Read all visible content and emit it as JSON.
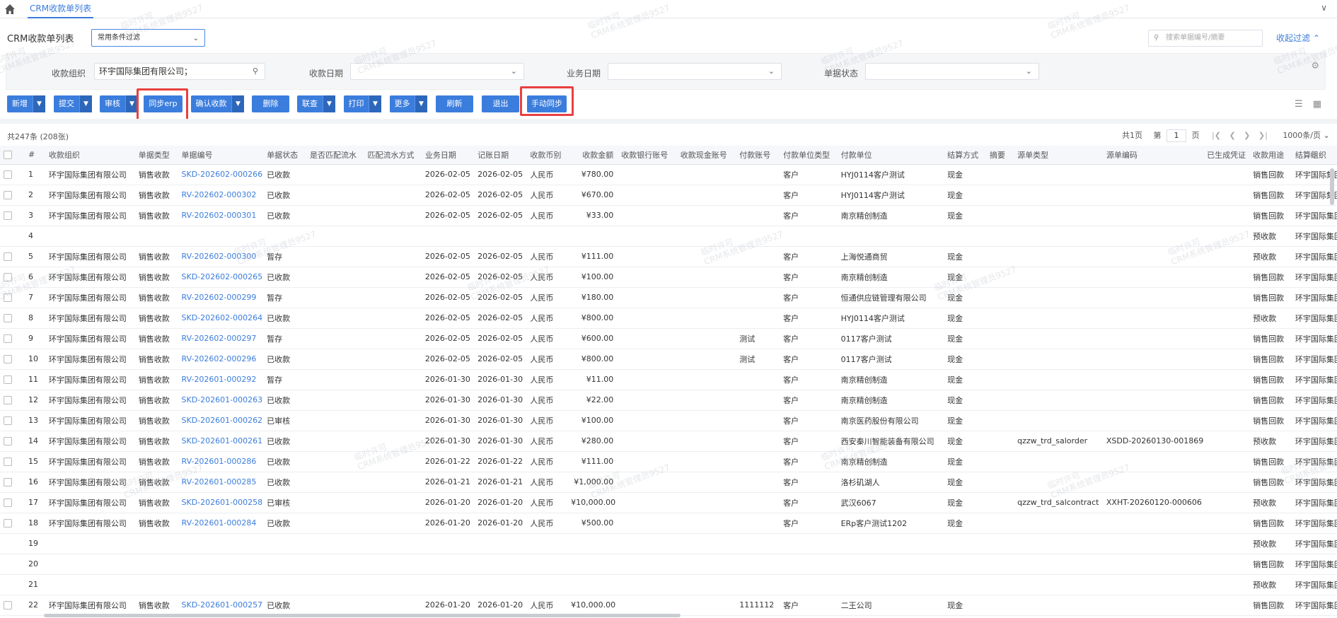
{
  "tab": {
    "label": "CRM收款单列表"
  },
  "page": {
    "title": "CRM收款单列表",
    "filter_scheme": "常用条件过滤",
    "search_placeholder": "搜索单据编号/摘要",
    "collapse_filter": "收起过滤"
  },
  "filters": {
    "org_label": "收款组织",
    "org_value": "环宇国际集团有限公司；",
    "date_label": "收款日期",
    "biz_date_label": "业务日期",
    "status_label": "单据状态"
  },
  "toolbar": {
    "add": "新增",
    "submit": "提交",
    "audit": "审核",
    "sync_erp": "同步erp",
    "confirm": "确认收款",
    "delete": "删除",
    "link": "联查",
    "print": "打印",
    "more": "更多",
    "refresh": "刷新",
    "exit": "退出",
    "manual_sync": "手动同步"
  },
  "list": {
    "summary": "共247条 (208张)",
    "pager": {
      "pages": "共1页",
      "page_prefix": "第",
      "page": "1",
      "page_suffix": "页",
      "page_size": "1000条/页"
    }
  },
  "columns": [
    "#",
    "收款组织",
    "单据类型",
    "单据编号",
    "单据状态",
    "是否匹配流水",
    "匹配流水方式",
    "业务日期",
    "记账日期",
    "收款币别",
    "收款金额",
    "收款银行账号",
    "收款现金账号",
    "付款账号",
    "付款单位类型",
    "付款单位",
    "结算方式",
    "摘要",
    "源单类型",
    "源单编码",
    "已生成凭证",
    "收款用途",
    "结算组织"
  ],
  "rows": [
    {
      "no": "1",
      "org": "环宇国际集团有限公司",
      "type": "销售收款",
      "bill": "SKD-202602-000266",
      "status": "已收款",
      "biz": "2026-02-05",
      "acc": "2026-02-05",
      "cur": "人民币",
      "amt": "¥780.00",
      "payacc": "",
      "ptype": "客户",
      "payer": "HYJ0114客户测试",
      "settle": "现金",
      "srctype": "",
      "srccode": "",
      "use": "销售回款",
      "sorg": "环宇国际集团有限"
    },
    {
      "no": "2",
      "org": "环宇国际集团有限公司",
      "type": "销售收款",
      "bill": "RV-202602-000302",
      "status": "已收款",
      "biz": "2026-02-05",
      "acc": "2026-02-05",
      "cur": "人民币",
      "amt": "¥670.00",
      "payacc": "",
      "ptype": "客户",
      "payer": "HYJ0114客户测试",
      "settle": "现金",
      "srctype": "",
      "srccode": "",
      "use": "销售回款",
      "sorg": "环宇国际集团有限"
    },
    {
      "no": "3",
      "org": "环宇国际集团有限公司",
      "type": "销售收款",
      "bill": "RV-202602-000301",
      "status": "已收款",
      "biz": "2026-02-05",
      "acc": "2026-02-05",
      "cur": "人民币",
      "amt": "¥33.00",
      "payacc": "",
      "ptype": "客户",
      "payer": "南京精创制造",
      "settle": "现金",
      "srctype": "",
      "srccode": "",
      "use": "销售回款",
      "sorg": "环宇国际集团有限"
    },
    {
      "no": "4",
      "org": "",
      "type": "",
      "bill": "",
      "status": "",
      "biz": "",
      "acc": "",
      "cur": "",
      "amt": "",
      "payacc": "",
      "ptype": "",
      "payer": "",
      "settle": "",
      "srctype": "",
      "srccode": "",
      "use": "预收款",
      "sorg": "环宇国际集团有限"
    },
    {
      "no": "5",
      "org": "环宇国际集团有限公司",
      "type": "销售收款",
      "bill": "RV-202602-000300",
      "status": "暂存",
      "biz": "2026-02-05",
      "acc": "2026-02-05",
      "cur": "人民币",
      "amt": "¥111.00",
      "payacc": "",
      "ptype": "客户",
      "payer": "上海悦通商贸",
      "settle": "现金",
      "srctype": "",
      "srccode": "",
      "use": "预收款",
      "sorg": "环宇国际集团有限"
    },
    {
      "no": "6",
      "org": "环宇国际集团有限公司",
      "type": "销售收款",
      "bill": "SKD-202602-000265",
      "status": "已收款",
      "biz": "2026-02-05",
      "acc": "2026-02-05",
      "cur": "人民币",
      "amt": "¥100.00",
      "payacc": "",
      "ptype": "客户",
      "payer": "南京精创制造",
      "settle": "现金",
      "srctype": "",
      "srccode": "",
      "use": "销售回款",
      "sorg": "环宇国际集团有限"
    },
    {
      "no": "7",
      "org": "环宇国际集团有限公司",
      "type": "销售收款",
      "bill": "RV-202602-000299",
      "status": "暂存",
      "biz": "2026-02-05",
      "acc": "2026-02-05",
      "cur": "人民币",
      "amt": "¥180.00",
      "payacc": "",
      "ptype": "客户",
      "payer": "恒通供应链管理有限公司",
      "settle": "现金",
      "srctype": "",
      "srccode": "",
      "use": "销售回款",
      "sorg": "环宇国际集团有限"
    },
    {
      "no": "8",
      "org": "环宇国际集团有限公司",
      "type": "销售收款",
      "bill": "SKD-202602-000264",
      "status": "已收款",
      "biz": "2026-02-05",
      "acc": "2026-02-05",
      "cur": "人民币",
      "amt": "¥800.00",
      "payacc": "",
      "ptype": "客户",
      "payer": "HYJ0114客户测试",
      "settle": "现金",
      "srctype": "",
      "srccode": "",
      "use": "预收款",
      "sorg": "环宇国际集团有限"
    },
    {
      "no": "9",
      "org": "环宇国际集团有限公司",
      "type": "销售收款",
      "bill": "RV-202602-000297",
      "status": "暂存",
      "biz": "2026-02-05",
      "acc": "2026-02-05",
      "cur": "人民币",
      "amt": "¥600.00",
      "payacc": "测试",
      "ptype": "客户",
      "payer": "0117客户测试",
      "settle": "现金",
      "srctype": "",
      "srccode": "",
      "use": "销售回款",
      "sorg": "环宇国际集团有限"
    },
    {
      "no": "10",
      "org": "环宇国际集团有限公司",
      "type": "销售收款",
      "bill": "RV-202602-000296",
      "status": "已收款",
      "biz": "2026-02-05",
      "acc": "2026-02-05",
      "cur": "人民币",
      "amt": "¥800.00",
      "payacc": "测试",
      "ptype": "客户",
      "payer": "0117客户测试",
      "settle": "现金",
      "srctype": "",
      "srccode": "",
      "use": "销售回款",
      "sorg": "环宇国际集团有限"
    },
    {
      "no": "11",
      "org": "环宇国际集团有限公司",
      "type": "销售收款",
      "bill": "RV-202601-000292",
      "status": "暂存",
      "biz": "2026-01-30",
      "acc": "2026-01-30",
      "cur": "人民币",
      "amt": "¥11.00",
      "payacc": "",
      "ptype": "客户",
      "payer": "南京精创制造",
      "settle": "现金",
      "srctype": "",
      "srccode": "",
      "use": "销售回款",
      "sorg": "环宇国际集团有限"
    },
    {
      "no": "12",
      "org": "环宇国际集团有限公司",
      "type": "销售收款",
      "bill": "SKD-202601-000263",
      "status": "已收款",
      "biz": "2026-01-30",
      "acc": "2026-01-30",
      "cur": "人民币",
      "amt": "¥22.00",
      "payacc": "",
      "ptype": "客户",
      "payer": "南京精创制造",
      "settle": "现金",
      "srctype": "",
      "srccode": "",
      "use": "销售回款",
      "sorg": "环宇国际集团有限"
    },
    {
      "no": "13",
      "org": "环宇国际集团有限公司",
      "type": "销售收款",
      "bill": "SKD-202601-000262",
      "status": "已审核",
      "biz": "2026-01-30",
      "acc": "2026-01-30",
      "cur": "人民币",
      "amt": "¥100.00",
      "payacc": "",
      "ptype": "客户",
      "payer": "南京医药股份有限公司",
      "settle": "现金",
      "srctype": "",
      "srccode": "",
      "use": "销售回款",
      "sorg": "环宇国际集团有限"
    },
    {
      "no": "14",
      "org": "环宇国际集团有限公司",
      "type": "销售收款",
      "bill": "SKD-202601-000261",
      "status": "已收款",
      "biz": "2026-01-30",
      "acc": "2026-01-30",
      "cur": "人民币",
      "amt": "¥280.00",
      "payacc": "",
      "ptype": "客户",
      "payer": "西安秦川智能装备有限公司",
      "settle": "现金",
      "srctype": "qzzw_trd_salorder",
      "srccode": "XSDD-20260130-001869",
      "use": "预收款",
      "sorg": "环宇国际集团有限"
    },
    {
      "no": "15",
      "org": "环宇国际集团有限公司",
      "type": "销售收款",
      "bill": "RV-202601-000286",
      "status": "已收款",
      "biz": "2026-01-22",
      "acc": "2026-01-22",
      "cur": "人民币",
      "amt": "¥111.00",
      "payacc": "",
      "ptype": "客户",
      "payer": "南京精创制造",
      "settle": "现金",
      "srctype": "",
      "srccode": "",
      "use": "销售回款",
      "sorg": "环宇国际集团有限"
    },
    {
      "no": "16",
      "org": "环宇国际集团有限公司",
      "type": "销售收款",
      "bill": "RV-202601-000285",
      "status": "已收款",
      "biz": "2026-01-21",
      "acc": "2026-01-21",
      "cur": "人民币",
      "amt": "¥1,000.00",
      "payacc": "",
      "ptype": "客户",
      "payer": "洛杉矶湖人",
      "settle": "现金",
      "srctype": "",
      "srccode": "",
      "use": "销售回款",
      "sorg": "环宇国际集团有限"
    },
    {
      "no": "17",
      "org": "环宇国际集团有限公司",
      "type": "销售收款",
      "bill": "SKD-202601-000258",
      "status": "已审核",
      "biz": "2026-01-20",
      "acc": "2026-01-20",
      "cur": "人民币",
      "amt": "¥10,000.00",
      "payacc": "",
      "ptype": "客户",
      "payer": "武汉6067",
      "settle": "现金",
      "srctype": "qzzw_trd_salcontract",
      "srccode": "XXHT-20260120-000606",
      "use": "预收款",
      "sorg": "环宇国际集团有限"
    },
    {
      "no": "18",
      "org": "环宇国际集团有限公司",
      "type": "销售收款",
      "bill": "RV-202601-000284",
      "status": "已收款",
      "biz": "2026-01-20",
      "acc": "2026-01-20",
      "cur": "人民币",
      "amt": "¥500.00",
      "payacc": "",
      "ptype": "客户",
      "payer": "ERp客户测试1202",
      "settle": "现金",
      "srctype": "",
      "srccode": "",
      "use": "销售回款",
      "sorg": "环宇国际集团有限"
    },
    {
      "no": "19",
      "org": "",
      "type": "",
      "bill": "",
      "status": "",
      "biz": "",
      "acc": "",
      "cur": "",
      "amt": "",
      "payacc": "",
      "ptype": "",
      "payer": "",
      "settle": "",
      "srctype": "",
      "srccode": "",
      "use": "预收款",
      "sorg": "环宇国际集团有限"
    },
    {
      "no": "20",
      "org": "",
      "type": "",
      "bill": "",
      "status": "",
      "biz": "",
      "acc": "",
      "cur": "",
      "amt": "",
      "payacc": "",
      "ptype": "",
      "payer": "",
      "settle": "",
      "srctype": "",
      "srccode": "",
      "use": "销售回款",
      "sorg": "环宇国际集团有限"
    },
    {
      "no": "21",
      "org": "",
      "type": "",
      "bill": "",
      "status": "",
      "biz": "",
      "acc": "",
      "cur": "",
      "amt": "",
      "payacc": "",
      "ptype": "",
      "payer": "",
      "settle": "",
      "srctype": "",
      "srccode": "",
      "use": "预收款",
      "sorg": "环宇国际集团有限"
    },
    {
      "no": "22",
      "org": "环宇国际集团有限公司",
      "type": "销售收款",
      "bill": "SKD-202601-000257",
      "status": "已收款",
      "biz": "2026-01-20",
      "acc": "2026-01-20",
      "cur": "人民币",
      "amt": "¥10,000.00",
      "payacc": "1111112",
      "ptype": "客户",
      "payer": "二王公司",
      "settle": "现金",
      "srctype": "",
      "srccode": "",
      "use": "销售回款",
      "sorg": "环宇国际集团有限"
    }
  ],
  "watermark": [
    "临时许可",
    "CRM系统管理员9527"
  ]
}
